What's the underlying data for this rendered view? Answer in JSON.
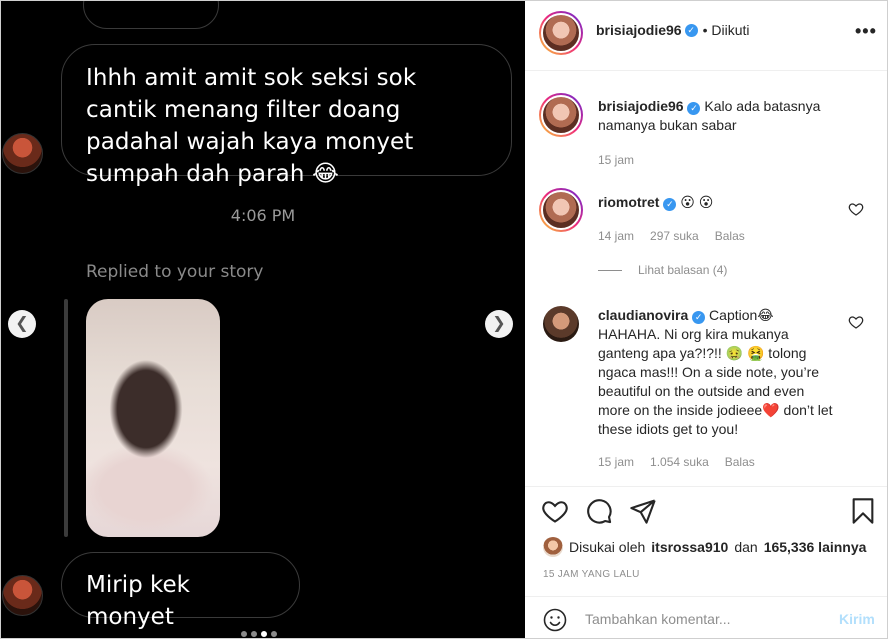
{
  "story": {
    "message_main": "Ihhh amit amit sok seksi sok cantik menang filter doang padahal wajah kaya  monyet sumpah dah parah 😂",
    "time": "4:06 PM",
    "replied_label": "Replied to your story",
    "message_last": "Mirip kek monyet",
    "prev_icon": "chevron-left-icon",
    "next_icon": "chevron-right-icon",
    "carousel_position": "3 of 4"
  },
  "post": {
    "author": "brisiajodie96",
    "follow_state": "• Diikuti",
    "caption": "Kalo ada batasnya namanya bukan sabar",
    "caption_time": "15 jam"
  },
  "comments": [
    {
      "username": "riomotret",
      "text": "😮 😮",
      "time": "14 jam",
      "likes": "297 suka",
      "reply_label": "Balas",
      "view_replies": "Lihat balasan (4)"
    },
    {
      "username": "claudianovira",
      "text": "Caption😂 HAHAHA. Ni org kira mukanya ganteng apa ya?!?!! 🤢 🤮 tolong ngaca mas!!! On a side note, you’re beautiful on the outside and even more on the inside jodieee❤️ don’t let these idiots get to you!",
      "time": "15 jam",
      "likes": "1.054 suka",
      "reply_label": "Balas"
    }
  ],
  "likes": {
    "prefix": "Disukai oleh",
    "user": "itsrossa910",
    "middle": "dan",
    "count": "165,336 lainnya"
  },
  "timestamp": "15 JAM YANG LALU",
  "add_comment": {
    "placeholder": "Tambahkan komentar...",
    "post_label": "Kirim"
  },
  "icons": {
    "more": "more-icon",
    "heart": "heart-icon",
    "comment": "comment-icon",
    "share": "share-icon",
    "bookmark": "bookmark-icon",
    "emoji": "smile-icon"
  },
  "colors": {
    "verified": "#3897f0",
    "secondary_text": "#8e8e8e",
    "post_button_disabled": "#b2dffc"
  }
}
